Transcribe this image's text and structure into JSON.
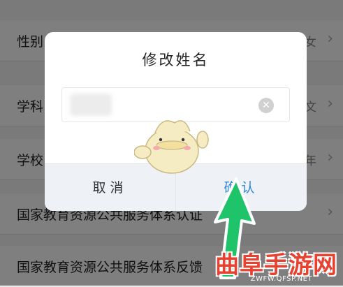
{
  "background_rows": [
    {
      "label": "性别",
      "value": "女"
    },
    {
      "label": "学科",
      "value": "文"
    },
    {
      "label": "学校",
      "value": "年"
    },
    {
      "label": "国家教育资源公共服务体系认证",
      "value": ""
    },
    {
      "label": "国家教育资源公共服务体系反馈",
      "value": ""
    }
  ],
  "dialog": {
    "title": "修改姓名",
    "name_value": "",
    "cancel_label": "取消",
    "confirm_label": "确认"
  },
  "icons": {
    "clear": "clear-icon",
    "chevron": "chevron-right-icon"
  },
  "watermark": {
    "title": "曲阜手游网",
    "url": "ZWFW.QFSP.NET"
  },
  "colors": {
    "confirm": "#2f87d8",
    "arrow": "#1fc36a",
    "watermark": "#e8412f"
  }
}
